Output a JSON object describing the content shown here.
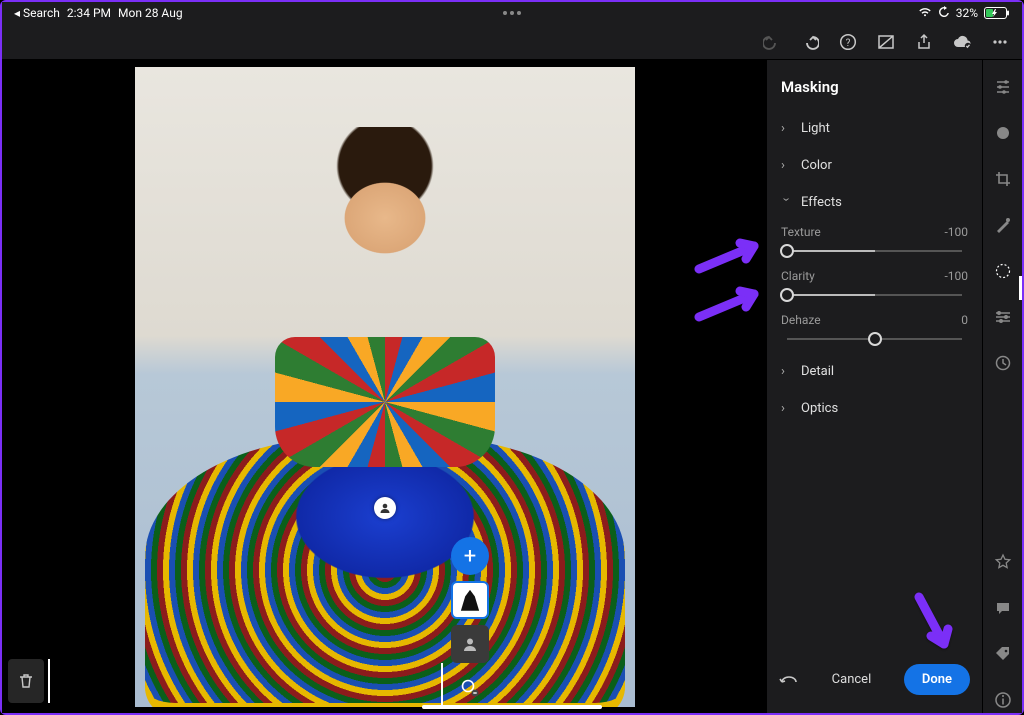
{
  "statusbar": {
    "back_app": "◂ Search",
    "time": "2:34 PM",
    "date": "Mon 28 Aug",
    "battery_pct": "32%"
  },
  "panel": {
    "title": "Masking",
    "groups": {
      "light": "Light",
      "color": "Color",
      "effects": "Effects",
      "detail": "Detail",
      "optics": "Optics"
    },
    "sliders": {
      "texture": {
        "label": "Texture",
        "value": "-100",
        "pos": 0
      },
      "clarity": {
        "label": "Clarity",
        "value": "-100",
        "pos": 0
      },
      "dehaze": {
        "label": "Dehaze",
        "value": "0",
        "pos": 50
      }
    }
  },
  "footer": {
    "cancel": "Cancel",
    "done": "Done"
  }
}
